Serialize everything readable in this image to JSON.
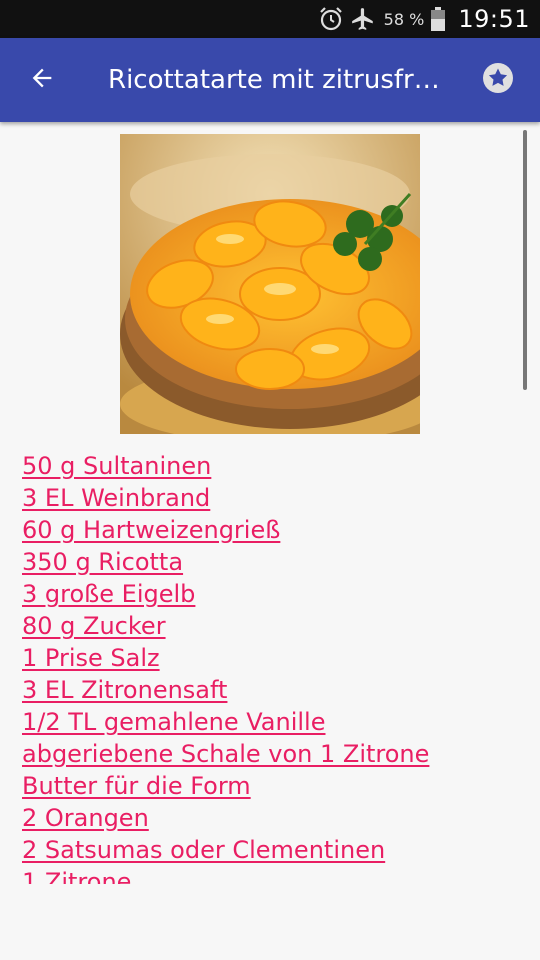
{
  "status_bar": {
    "icons": [
      "alarm-icon",
      "airplane-mode-icon",
      "battery-icon"
    ],
    "battery_percent": "58 %",
    "time": "19:51"
  },
  "app_bar": {
    "title": "Ricottatarte mit zitrusfr…",
    "back_icon": "arrow-back-icon",
    "favorite_icon": "star-icon",
    "color": "#3949ab"
  },
  "recipe": {
    "image_description_icon": "tart-photo",
    "ingredients": [
      "50 g Sultaninen",
      "3 EL Weinbrand",
      "60 g Hartweizengrieß",
      "350 g Ricotta",
      "3 große Eigelb",
      "80 g Zucker",
      "1 Prise Salz",
      "3 EL Zitronensaft",
      "1/2 TL gemahlene Vanille",
      "abgeriebene Schale von 1 Zitrone",
      "Butter für die Form",
      "2 Orangen",
      "2 Satsumas oder Clementinen",
      "1 Zitrone"
    ],
    "link_color": "#e91e63"
  }
}
